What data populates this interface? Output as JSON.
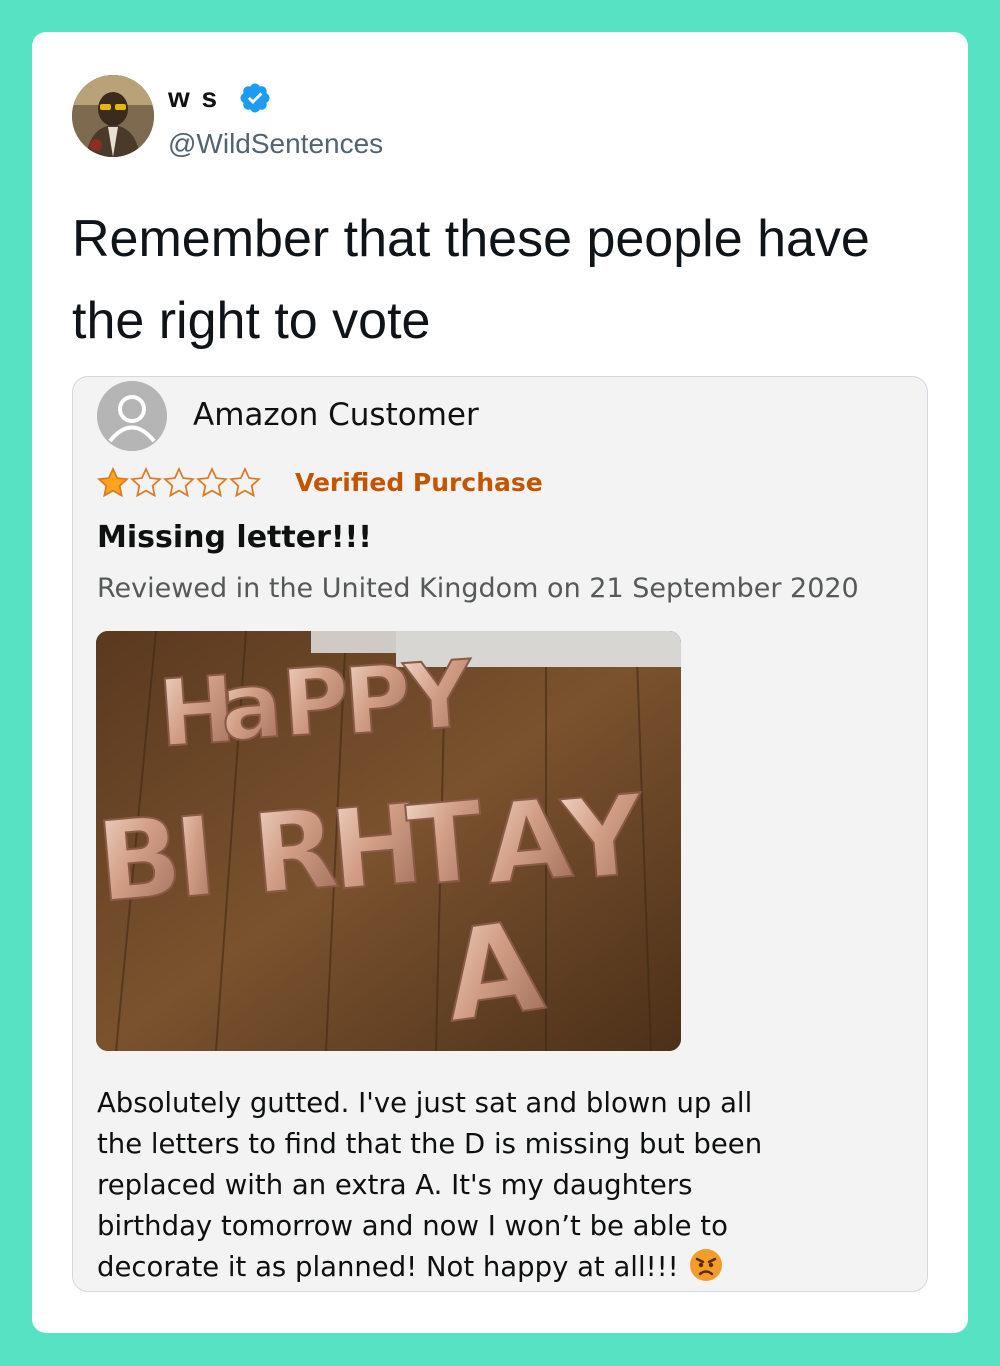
{
  "tweet": {
    "author": {
      "display_name": "w s",
      "verified": true,
      "handle": "@WildSentences"
    },
    "text": "Remember that these people have the right to vote"
  },
  "review": {
    "customer_name": "Amazon Customer",
    "rating": 1,
    "rating_max": 5,
    "verified_label": "Verified Purchase",
    "title": "Missing letter!!!",
    "meta": "Reviewed in the United Kingdom on 21 September 2020",
    "photo_letters": {
      "line1": [
        "H",
        "a",
        "P",
        "P",
        "Y"
      ],
      "line2": [
        "B",
        "I",
        "R",
        "H",
        "T",
        "A",
        "Y"
      ],
      "line3": [
        "A"
      ]
    },
    "body": "Absolutely gutted. I've just sat and blown up all the letters to find that the D is missing but been replaced with an extra A. It's my daughters birthday tomorrow and now I won’t be able to decorate it as planned! Not happy at all!!!",
    "body_emoji": "angry-face"
  },
  "colors": {
    "page_background": "#55e3c3",
    "card_background": "#ffffff",
    "verified_badge": "#1d9bf0",
    "amazon_star": "#ffa41c",
    "verified_purchase_text": "#c45500",
    "review_background": "#f3f3f3"
  }
}
